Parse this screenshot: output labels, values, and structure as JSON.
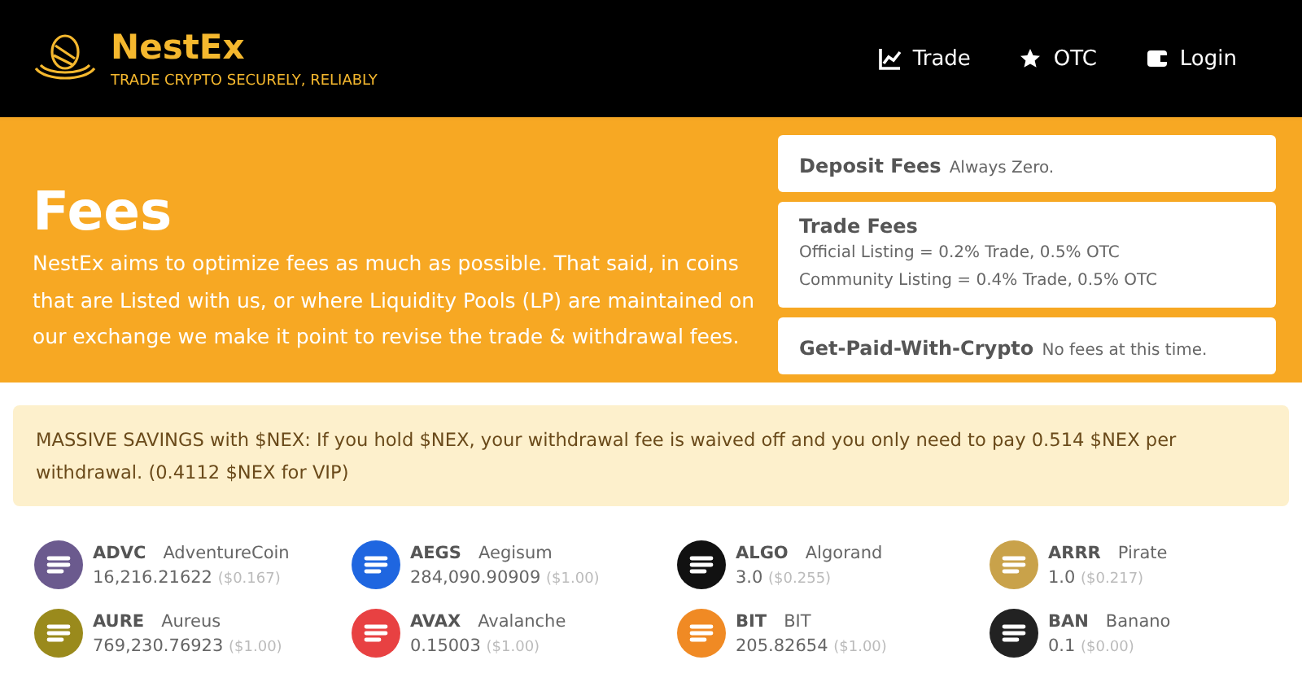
{
  "header": {
    "brand": "NestEx",
    "tagline": "TRADE CRYPTO SECURELY, RELIABLY",
    "nav": [
      {
        "label": "Trade",
        "kind": "chart"
      },
      {
        "label": "OTC",
        "kind": "star"
      },
      {
        "label": "Login",
        "kind": "wallet"
      }
    ]
  },
  "hero": {
    "title": "Fees",
    "text": "NestEx aims to optimize fees as much as possible. That said, in coins that are Listed with us, or where Liquidity Pools (LP) are maintained on our exchange we make it point to revise the trade & withdrawal fees.",
    "cards": [
      {
        "title": "Deposit Fees",
        "lines": [
          "Always Zero."
        ],
        "kind": "inline"
      },
      {
        "title": "Trade Fees",
        "lines": [
          "Official Listing = 0.2% Trade, 0.5% OTC",
          "Community Listing = 0.4% Trade, 0.5% OTC"
        ],
        "kind": "stacked"
      },
      {
        "title": "Get-Paid-With-Crypto",
        "lines": [
          "No fees at this time."
        ],
        "kind": "inline"
      }
    ]
  },
  "notice": "MASSIVE SAVINGS with $NEX: If you hold $NEX, your withdrawal fee is waived off and you only need to pay 0.514 $NEX per withdrawal. (0.4112 $NEX for VIP)",
  "coins": [
    {
      "symbol": "ADVC",
      "name": "AdventureCoin",
      "amount": "16,216.21622",
      "price": "($0.167)",
      "color": "#6b5a8e"
    },
    {
      "symbol": "AEGS",
      "name": "Aegisum",
      "amount": "284,090.90909",
      "price": "($1.00)",
      "color": "#1f66e0"
    },
    {
      "symbol": "ALGO",
      "name": "Algorand",
      "amount": "3.0",
      "price": "($0.255)",
      "color": "#111111"
    },
    {
      "symbol": "ARRR",
      "name": "Pirate",
      "amount": "1.0",
      "price": "($0.217)",
      "color": "#c9a24a"
    },
    {
      "symbol": "AURE",
      "name": "Aureus",
      "amount": "769,230.76923",
      "price": "($1.00)",
      "color": "#9a8a1c"
    },
    {
      "symbol": "AVAX",
      "name": "Avalanche",
      "amount": "0.15003",
      "price": "($1.00)",
      "color": "#e84142"
    },
    {
      "symbol": "BIT",
      "name": "BIT",
      "amount": "205.82654",
      "price": "($1.00)",
      "color": "#f08a24"
    },
    {
      "symbol": "BAN",
      "name": "Banano",
      "amount": "0.1",
      "price": "($0.00)",
      "color": "#222222"
    }
  ]
}
